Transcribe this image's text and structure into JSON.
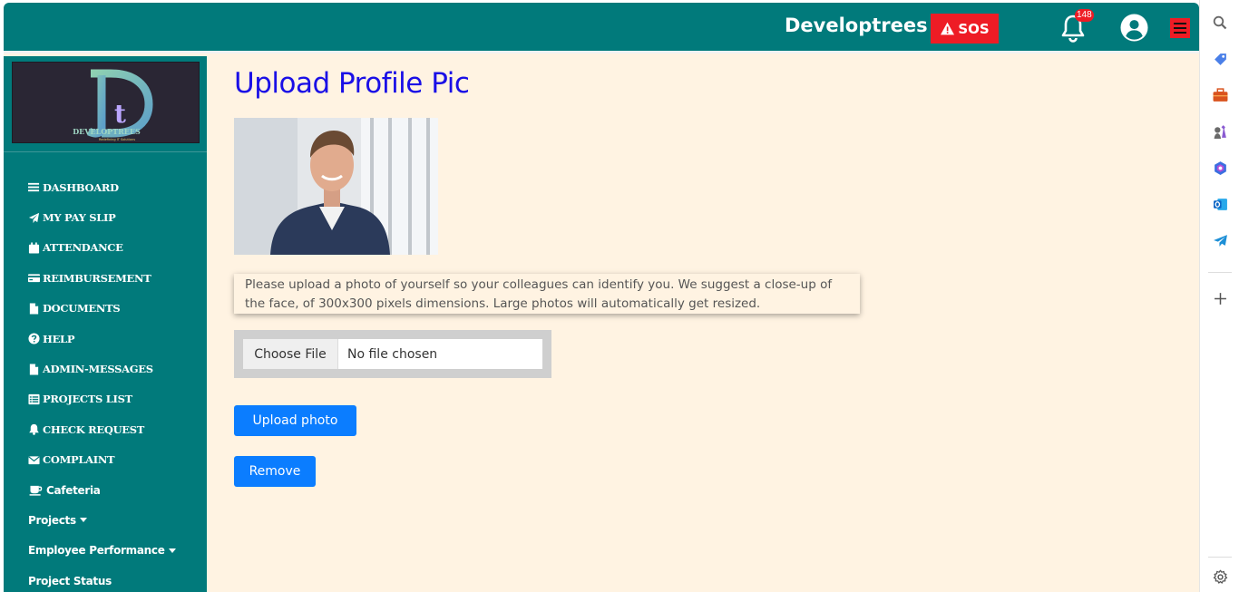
{
  "topbar": {
    "brand": "Developtrees",
    "sos_label": "SOS",
    "notification_count": "148",
    "colors": {
      "bar": "#017a7b",
      "sos": "#ee1c25"
    }
  },
  "sidebar": {
    "logo_text": "DEVELOPTREES",
    "logo_tagline": "Redefining IT Solutions",
    "items": [
      {
        "label": "DASHBOARD",
        "icon": "bars-icon"
      },
      {
        "label": "MY PAY SLIP",
        "icon": "paper-plane-icon"
      },
      {
        "label": "ATTENDANCE",
        "icon": "calendar-icon"
      },
      {
        "label": "REIMBURSEMENT",
        "icon": "credit-card-icon"
      },
      {
        "label": "DOCUMENTS",
        "icon": "file-icon"
      },
      {
        "label": "HELP",
        "icon": "question-circle-icon"
      },
      {
        "label": "ADMIN-MESSAGES",
        "icon": "file-icon"
      },
      {
        "label": "PROJECTS LIST",
        "icon": "list-icon"
      },
      {
        "label": "CHECK REQUEST",
        "icon": "bell-icon"
      },
      {
        "label": "COMPLAINT",
        "icon": "envelope-icon"
      },
      {
        "label": "Cafeteria",
        "icon": "coffee-icon"
      },
      {
        "label": "Projects",
        "icon": "caret-down-icon"
      },
      {
        "label": "Employee Performance",
        "icon": "caret-down-icon"
      },
      {
        "label": "Project Status",
        "icon": ""
      }
    ]
  },
  "main": {
    "title": "Upload Profile Pic",
    "note": "Please upload a photo of yourself so your colleagues can identify you. We suggest a close-up of the face, of 300x300 pixels dimensions. Large photos will automatically get resized.",
    "file_input": {
      "button_label": "Choose File",
      "status": "No file chosen"
    },
    "upload_label": "Upload photo",
    "remove_label": "Remove",
    "accent": "#0b7dff",
    "title_color": "#1a0fe6"
  },
  "rail": {
    "icons": [
      "search-icon",
      "tag-icon",
      "briefcase-icon",
      "chess-icon",
      "copilot-icon",
      "outlook-icon",
      "send-icon",
      "plus-icon",
      "settings-icon"
    ]
  }
}
